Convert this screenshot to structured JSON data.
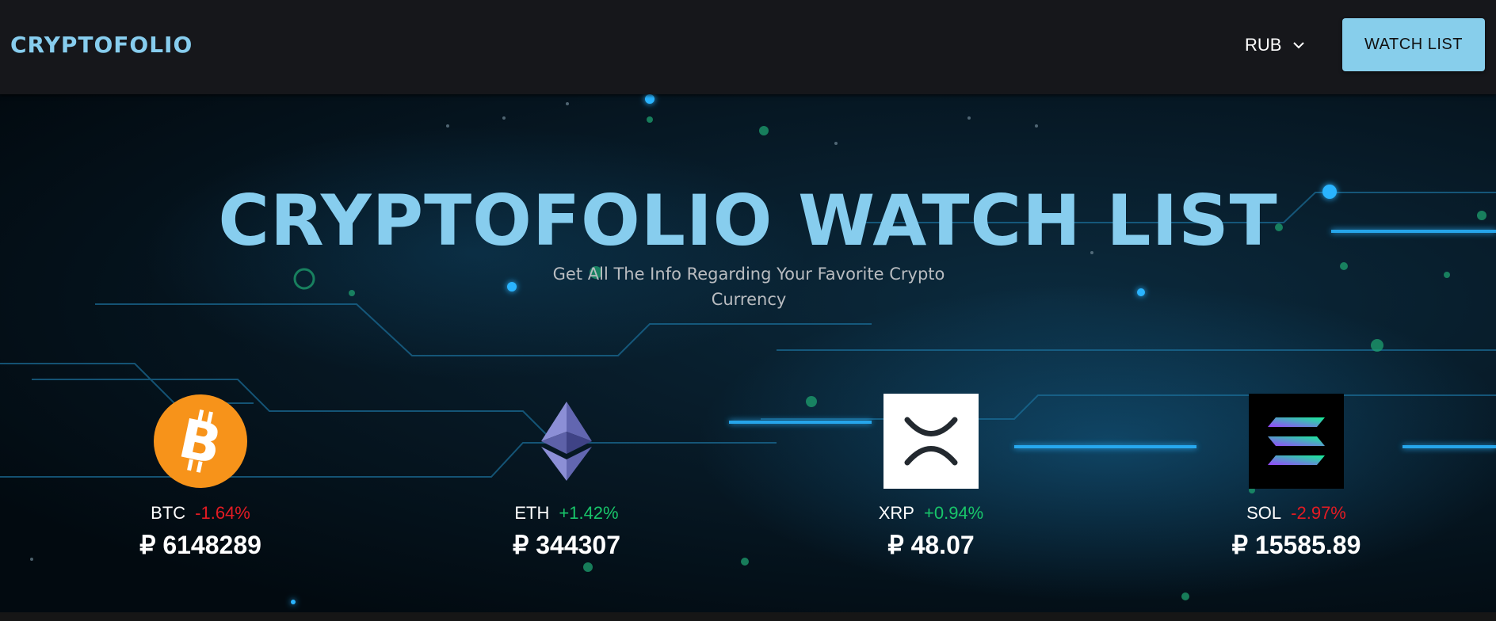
{
  "header": {
    "logo": "CRYPTOFOLIO",
    "currency": "RUB",
    "watch_list_button": "WATCH LIST"
  },
  "hero": {
    "title": "CRYPTOFOLIO WATCH LIST",
    "subtitle": "Get All The Info Regarding Your Favorite Crypto Currency"
  },
  "coins": [
    {
      "symbol": "BTC",
      "change": "-1.64%",
      "price": "₽ 6148289",
      "icon": "bitcoin-icon"
    },
    {
      "symbol": "ETH",
      "change": "+1.42%",
      "price": "₽ 344307",
      "icon": "ethereum-icon"
    },
    {
      "symbol": "XRP",
      "change": "+0.94%",
      "price": "₽ 48.07",
      "icon": "xrp-icon"
    },
    {
      "symbol": "SOL",
      "change": "-2.97%",
      "price": "₽ 15585.89",
      "icon": "solana-icon"
    }
  ],
  "colors": {
    "accent": "#87ceeb",
    "negative": "#e31b23",
    "positive": "#18c56a",
    "header_bg": "#16171b"
  }
}
